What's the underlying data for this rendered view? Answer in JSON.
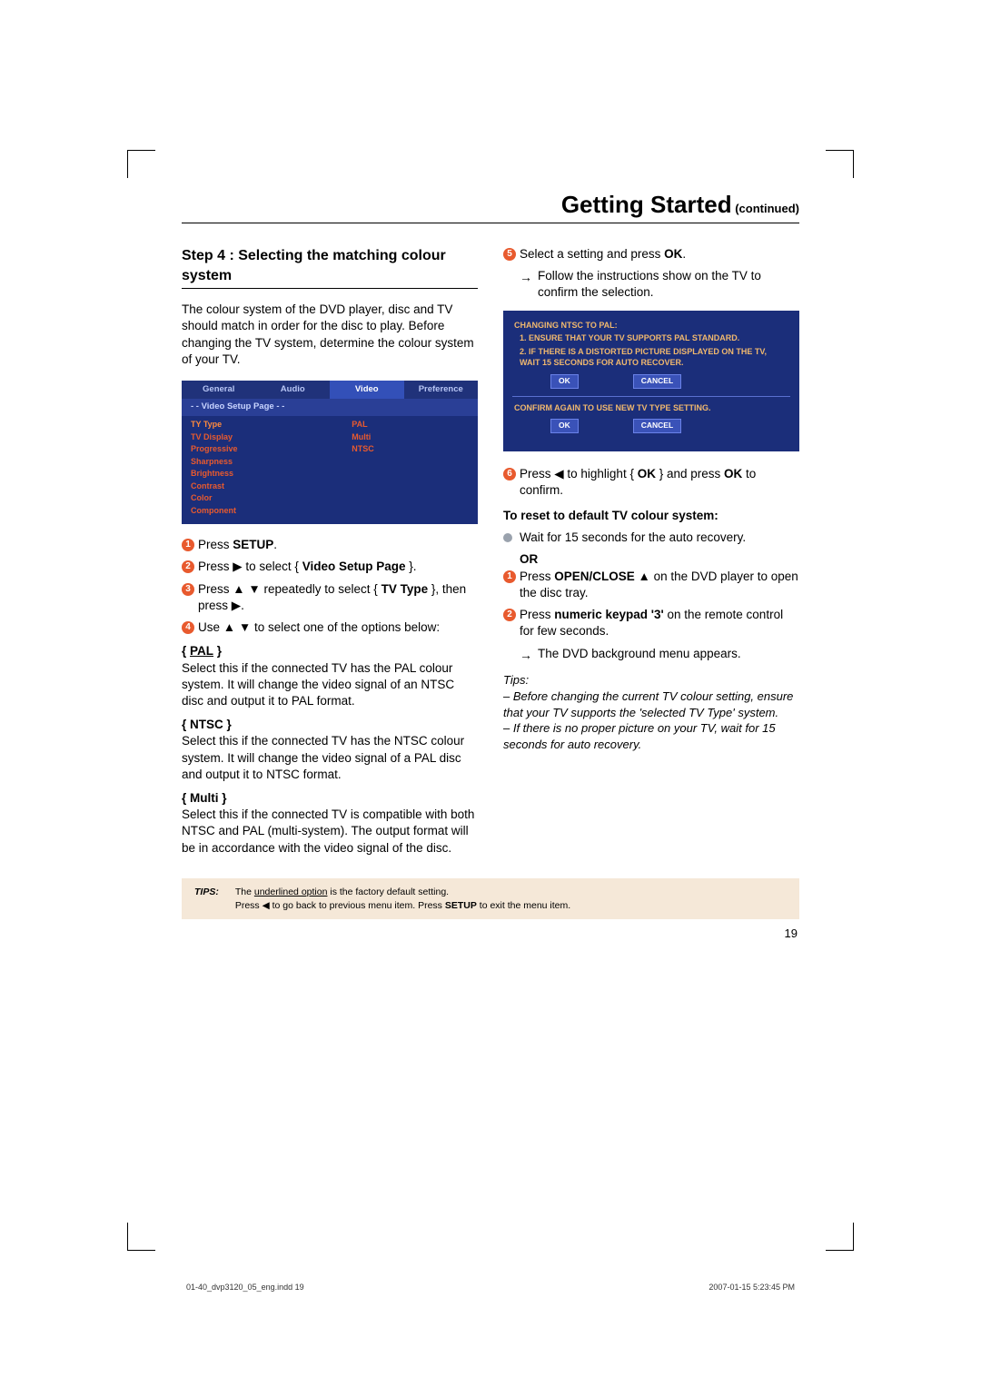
{
  "header": {
    "title_big": "Getting Started",
    "title_small": " (continued)"
  },
  "left": {
    "step_title": "Step 4 : Selecting the matching colour system",
    "intro": "The colour system of the DVD player, disc and TV should match in order for the disc to play. Before changing the TV system, determine the colour system of your TV.",
    "menu": {
      "tabs": [
        "General",
        "Audio",
        "Video",
        "Preference"
      ],
      "active_tab": 2,
      "subhead": "- -   Video Setup Page   - -",
      "rows": [
        "TY Type",
        "TV Display",
        "Progressive",
        "Sharpness",
        "Brightness",
        "Contrast",
        "Color",
        "Component"
      ],
      "opts": [
        "PAL",
        "Multi",
        "NTSC"
      ]
    },
    "steps": {
      "s1": "Press ",
      "s1b": "SETUP",
      "s1c": ".",
      "s2a": "Press ▶ to select { ",
      "s2b": "Video Setup Page",
      "s2c": " }.",
      "s3a": "Press ▲ ▼ repeatedly to select { ",
      "s3b": "TV Type",
      "s3c": " }, then press ▶.",
      "s4": "Use ▲ ▼ to select one of the options below:"
    },
    "opts": {
      "pal_label": "{ PAL }",
      "pal_desc": "Select this if the connected TV has the PAL colour system. It will change the video signal of an NTSC disc and output it to PAL format.",
      "ntsc_label": "{ NTSC }",
      "ntsc_desc": "Select this if the connected TV has the NTSC colour system. It will change the video signal of a PAL disc and output it to NTSC format.",
      "multi_label": "{ Multi }",
      "multi_desc": "Select this if the connected TV is compatible with both NTSC and PAL (multi-system). The output format will be in accordance with the video signal of the disc."
    }
  },
  "right": {
    "s5a": "Select a setting and press ",
    "s5b": "OK",
    "s5c": ".",
    "s5_arrow": "Follow the instructions show on the TV to confirm the selection.",
    "dialog": {
      "l1": "CHANGING NTSC TO PAL:",
      "l2": "1. ENSURE THAT YOUR TV SUPPORTS PAL STANDARD.",
      "l3": "2. IF THERE IS A DISTORTED PICTURE DISPLAYED ON THE TV, WAIT 15 SECONDS FOR AUTO RECOVER.",
      "ok": "OK",
      "cancel": "CANCEL",
      "l4": "CONFIRM AGAIN TO USE NEW TV TYPE SETTING."
    },
    "s6a": "Press ◀ to highlight { ",
    "s6b": "OK",
    "s6c": " } and press ",
    "s6d": "OK",
    "s6e": " to confirm.",
    "reset_head": "To reset to default TV colour system:",
    "wait": "Wait for 15 seconds for the auto recovery.",
    "or": "OR",
    "r1a": "Press ",
    "r1b": "OPEN/CLOSE",
    "r1c": " ▲ on the DVD player to open the disc tray.",
    "r2a": "Press ",
    "r2b": "numeric keypad '3'",
    "r2c": " on the remote control for few seconds.",
    "r2_arrow": "The DVD background menu appears.",
    "tips_label": "Tips:",
    "tip1": "– Before changing the current TV colour setting, ensure that your TV supports the 'selected TV Type' system.",
    "tip2": "– If there is no proper picture on your TV, wait for 15 seconds for auto recovery."
  },
  "footer": {
    "tips_label": "TIPS:",
    "tips_body1": "The underlined option is the factory default setting.",
    "tips_body2": "Press ◀ to go back to previous menu item. Press SETUP to exit the menu item.",
    "page_num": "19",
    "imprint_left": "01-40_dvp3120_05_eng.indd   19",
    "imprint_right": "2007-01-15   5:23:45 PM"
  }
}
